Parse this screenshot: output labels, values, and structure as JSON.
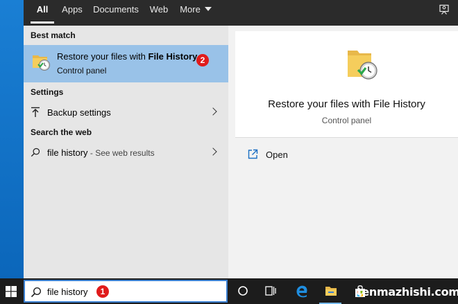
{
  "filter_tabs": [
    {
      "label": "All",
      "active": true
    },
    {
      "label": "Apps"
    },
    {
      "label": "Documents"
    },
    {
      "label": "Web"
    },
    {
      "label": "More"
    }
  ],
  "results": {
    "best_match": {
      "header": "Best match",
      "title_prefix": "Restore your files with ",
      "title_bold": "File History",
      "subtitle": "Control panel",
      "badge": "2"
    },
    "settings": {
      "header": "Settings",
      "items": [
        {
          "label": "Backup settings",
          "icon": "upload-arrow-icon"
        }
      ]
    },
    "web": {
      "header": "Search the web",
      "query": "file history",
      "suffix": " - See web results",
      "icon": "search-icon"
    }
  },
  "preview": {
    "title": "Restore your files with File History",
    "subtitle": "Control panel",
    "actions": [
      {
        "label": "Open",
        "icon": "open-external-icon"
      }
    ]
  },
  "taskbar": {
    "search_value": "file history",
    "search_badge": "1",
    "items": [
      "cortana-icon",
      "task-view-icon",
      "edge-icon",
      "file-explorer-icon",
      "store-icon"
    ]
  },
  "watermark": "tenmazhishi.com",
  "colors": {
    "accent": "#99c2e8",
    "taskbar": "#1c1c1c",
    "topbar": "#2b2b2b",
    "badge": "#e01b1b"
  }
}
